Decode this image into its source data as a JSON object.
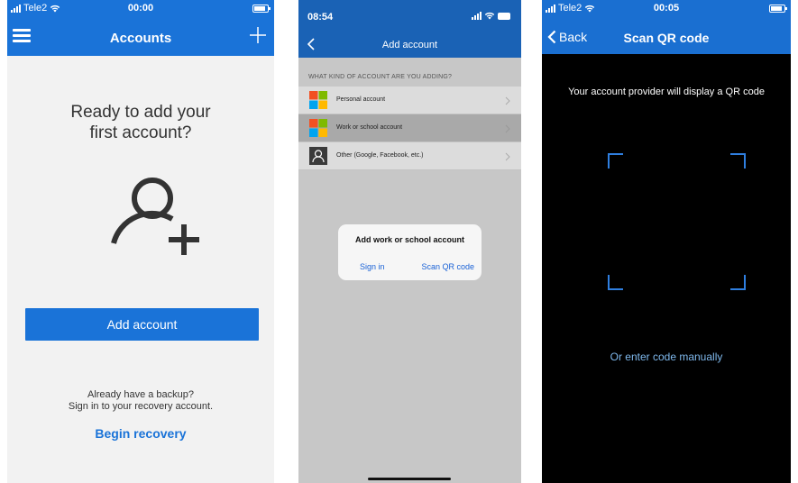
{
  "screen1": {
    "status": {
      "carrier": "Tele2",
      "time": "00:00"
    },
    "title": "Accounts",
    "heading_line1": "Ready to add your",
    "heading_line2": "first account?",
    "add_button": "Add account",
    "backup_line1": "Already have a backup?",
    "backup_line2": "Sign in to your recovery account.",
    "recovery_link": "Begin recovery",
    "colors": {
      "accent": "#1a73d8"
    },
    "icons": [
      "menu-icon",
      "plus-icon",
      "add-person-icon"
    ]
  },
  "screen2": {
    "status": {
      "time": "08:54"
    },
    "title": "Add account",
    "section_label": "WHAT KIND OF ACCOUNT ARE YOU ADDING?",
    "items": [
      {
        "label": "Personal account",
        "icon": "microsoft-logo-icon",
        "selected": false
      },
      {
        "label": "Work or school account",
        "icon": "microsoft-logo-icon",
        "selected": true
      },
      {
        "label": "Other (Google, Facebook, etc.)",
        "icon": "person-icon",
        "selected": false
      }
    ],
    "dialog": {
      "title": "Add work or school account",
      "sign_in": "Sign in",
      "scan_qr": "Scan QR code"
    }
  },
  "screen3": {
    "status": {
      "carrier": "Tele2",
      "time": "00:05"
    },
    "back_label": "Back",
    "title": "Scan QR code",
    "instruction": "Your account provider will display a QR code",
    "manual_link": "Or enter code manually",
    "colors": {
      "accent": "#1a6fd1",
      "link": "#7fb8ec"
    }
  }
}
